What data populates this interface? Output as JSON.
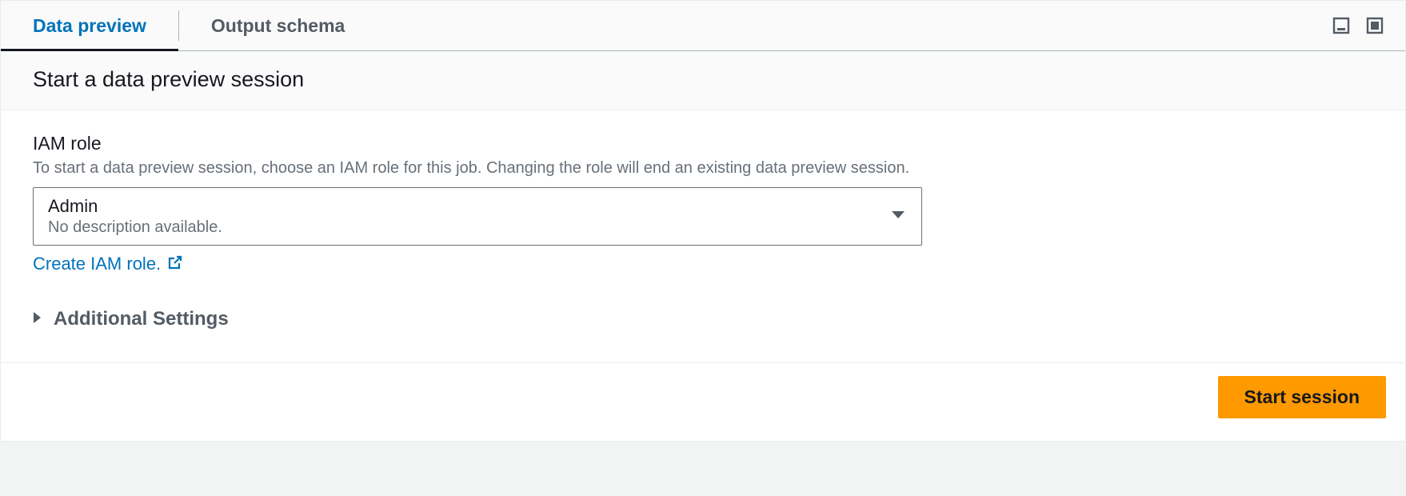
{
  "tabs": {
    "data_preview": "Data preview",
    "output_schema": "Output schema"
  },
  "panel": {
    "title": "Start a data preview session"
  },
  "iam": {
    "label": "IAM role",
    "description": "To start a data preview session, choose an IAM role for this job. Changing the role will end an existing data preview session.",
    "selected_value": "Admin",
    "selected_subtext": "No description available.",
    "create_link": "Create IAM role."
  },
  "expander": {
    "label": "Additional Settings"
  },
  "actions": {
    "start_session": "Start session"
  }
}
